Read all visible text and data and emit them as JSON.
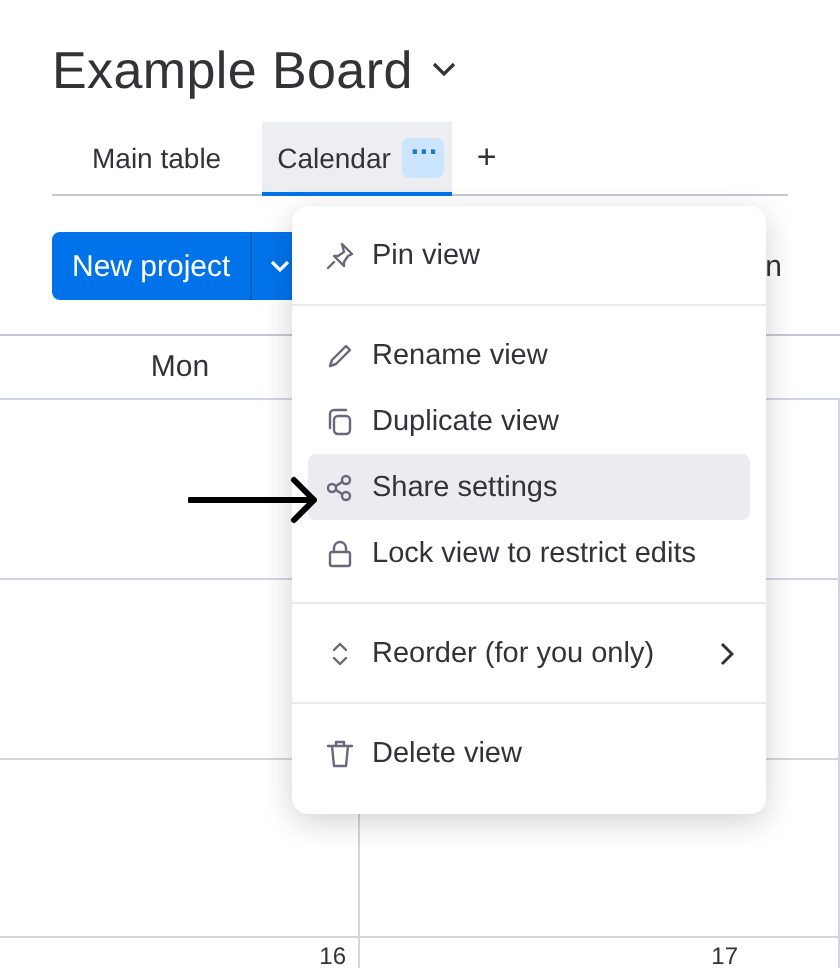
{
  "board": {
    "title": "Example Board"
  },
  "tabs": [
    {
      "label": "Main table",
      "selected": false
    },
    {
      "label": "Calendar",
      "selected": true,
      "menu_button": "···"
    },
    {
      "label": "+",
      "selected": false
    }
  ],
  "toolbar": {
    "new_button": "New project",
    "cut_label": "n"
  },
  "calendar": {
    "columns": [
      "Mon",
      "",
      ""
    ],
    "day_numbers": [
      "16",
      "17"
    ]
  },
  "menu": {
    "sections": [
      {
        "items": [
          {
            "label": "Pin view",
            "selected": false
          }
        ]
      },
      {
        "items": [
          {
            "label": "Rename view",
            "selected": false
          },
          {
            "label": "Duplicate view",
            "selected": false
          },
          {
            "label": "Share settings",
            "selected": true
          },
          {
            "label": "Lock view to restrict edits",
            "selected": false
          }
        ]
      },
      {
        "items": [
          {
            "label": "Reorder (for you only)",
            "selected": false,
            "submenu": true
          }
        ]
      },
      {
        "items": [
          {
            "label": "Delete view",
            "selected": false
          }
        ]
      }
    ]
  }
}
